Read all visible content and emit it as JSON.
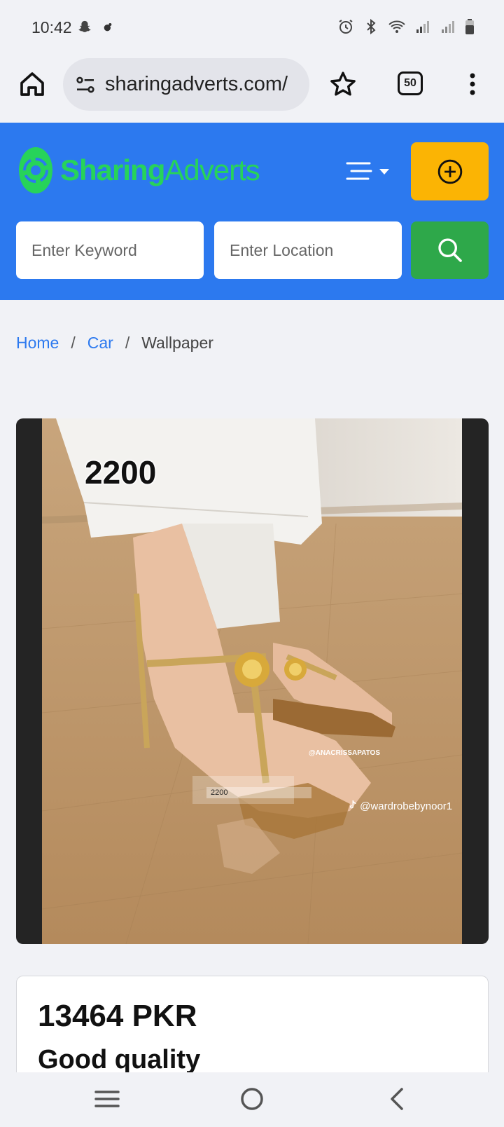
{
  "status_bar": {
    "time": "10:42",
    "left_icons": [
      "snapchat-icon",
      "notification-icon"
    ],
    "right_icons": [
      "alarm-icon",
      "bluetooth-icon",
      "wifi-icon",
      "signal-icon",
      "signal-icon",
      "battery-icon"
    ]
  },
  "browser": {
    "url": "sharingadverts.com/",
    "tab_count": "50"
  },
  "site": {
    "logo_part1": "Sharing",
    "logo_part2": "Adverts",
    "keyword_placeholder": "Enter Keyword",
    "location_placeholder": "Enter Location",
    "colors": {
      "header": "#2c79ef",
      "logo": "#27d35a",
      "post": "#fbb404",
      "search": "#2ea84a"
    }
  },
  "breadcrumb": {
    "home": "Home",
    "category": "Car",
    "current": "Wallpaper",
    "separator": "/"
  },
  "ad": {
    "image_overlay_price": "2200",
    "image_overlay_brand": "@ANACRISSAPATOS",
    "image_overlay_small_price": "2200",
    "image_overlay_tiktok": "@wardrobebynoor1",
    "price": "13464 PKR",
    "title": "Good quality"
  }
}
